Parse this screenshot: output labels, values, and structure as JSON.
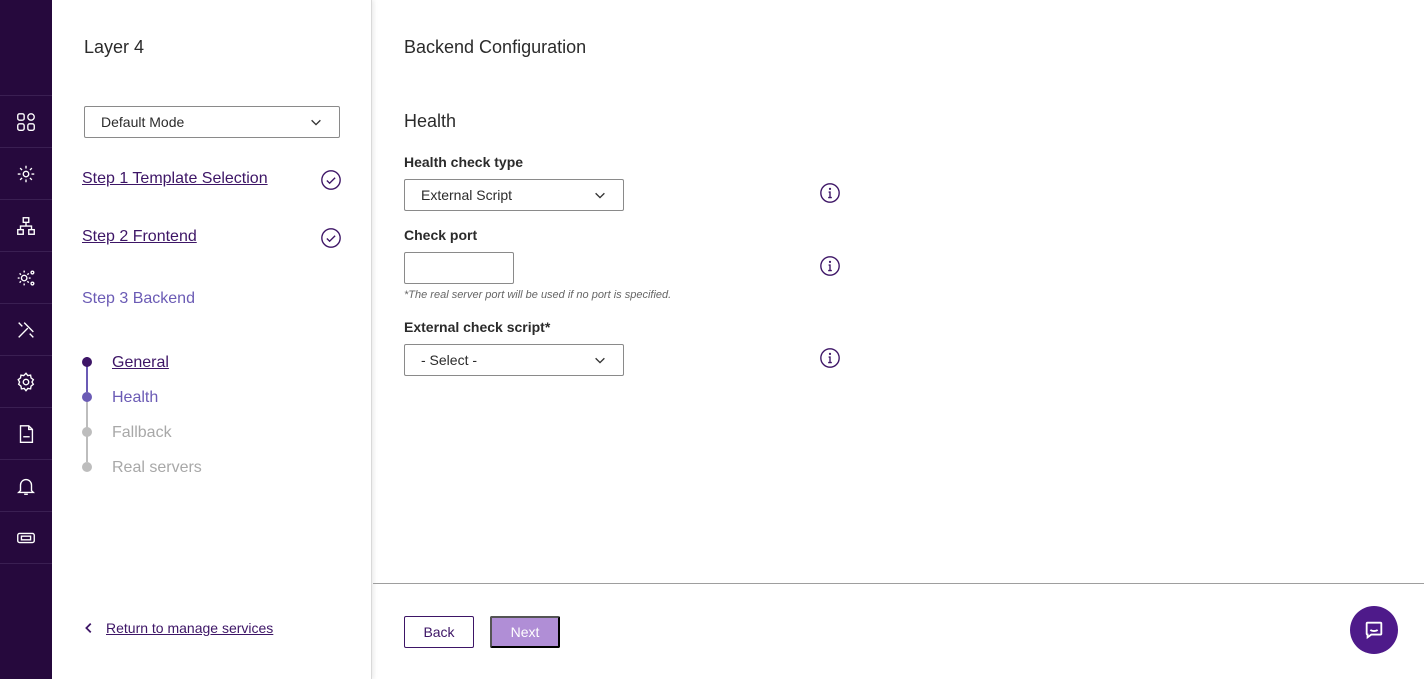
{
  "rail": {
    "icons": [
      "dashboard-icon",
      "services-icon",
      "network-icon",
      "system-settings-icon",
      "tools-icon",
      "settings-icon",
      "log-icon",
      "notifications-icon",
      "ticket-icon"
    ]
  },
  "wizard": {
    "title": "Layer 4",
    "mode": "Default Mode",
    "steps": [
      {
        "label": "Step 1 Template Selection",
        "state": "complete"
      },
      {
        "label": "Step 2 Frontend",
        "state": "complete"
      },
      {
        "label": "Step 3 Backend",
        "state": "current"
      }
    ],
    "substeps": [
      {
        "label": "General",
        "state": "done"
      },
      {
        "label": "Health",
        "state": "current"
      },
      {
        "label": "Fallback",
        "state": "pending"
      },
      {
        "label": "Real servers",
        "state": "pending"
      }
    ],
    "return_label": "Return to manage services"
  },
  "main": {
    "page_title": "Backend Configuration",
    "section_title": "Health",
    "health_check_type": {
      "label": "Health check type",
      "value": "External Script"
    },
    "check_port": {
      "label": "Check port",
      "value": "",
      "hint": "*The real server port will be used if no port is specified."
    },
    "external_check_script": {
      "label": "External check script*",
      "value": "- Select -"
    },
    "buttons": {
      "back": "Back",
      "next": "Next"
    }
  },
  "colors": {
    "rail_bg": "#26093d",
    "accent": "#3d1566",
    "current_step": "#6b5bb5",
    "next_disabled": "#b08ed6",
    "chat_bg": "#4e1a8a"
  }
}
